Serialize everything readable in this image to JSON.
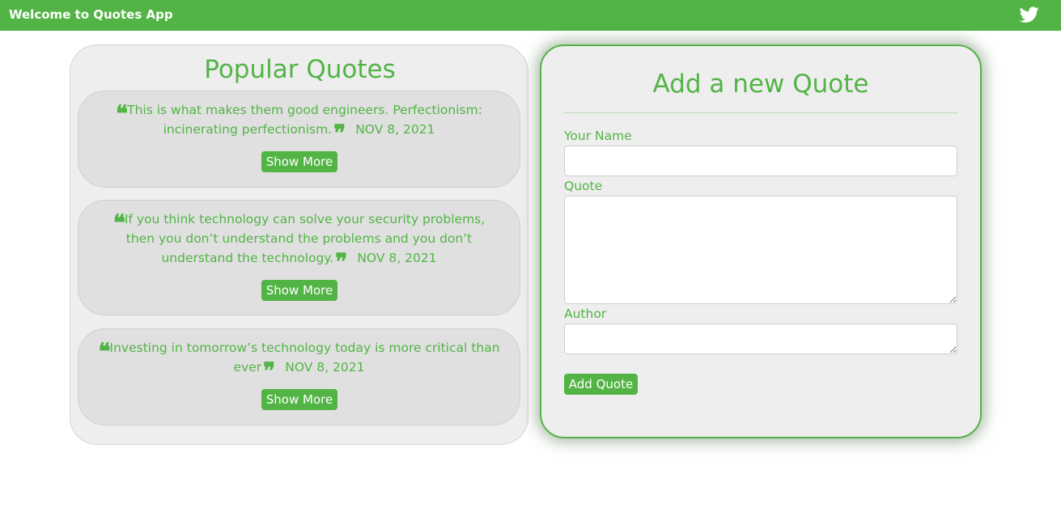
{
  "colors": {
    "accent": "#52b445",
    "panel_background": "#eeeeee",
    "card_background": "#e0e0e0"
  },
  "navbar": {
    "title": "Welcome to Quotes App",
    "icon": "twitter-icon"
  },
  "popular": {
    "title": "Popular Quotes",
    "quotes": [
      {
        "text": "This is what makes them good engineers. Perfectionism: incinerating perfectionism.",
        "date": "NOV 8, 2021",
        "button_label": "Show More"
      },
      {
        "text": "If you think technology can solve your security problems, then you don’t understand the problems and you don’t understand the technology.",
        "date": "NOV 8, 2021",
        "button_label": "Show More"
      },
      {
        "text": "Investing in tomorrow’s technology today is more critical than ever",
        "date": "NOV 8, 2021",
        "button_label": "Show More"
      }
    ]
  },
  "form": {
    "title": "Add a new Quote",
    "name_label": "Your Name",
    "name_value": "",
    "quote_label": "Quote",
    "quote_value": "",
    "author_label": "Author",
    "author_value": "",
    "submit_label": "Add Quote"
  }
}
